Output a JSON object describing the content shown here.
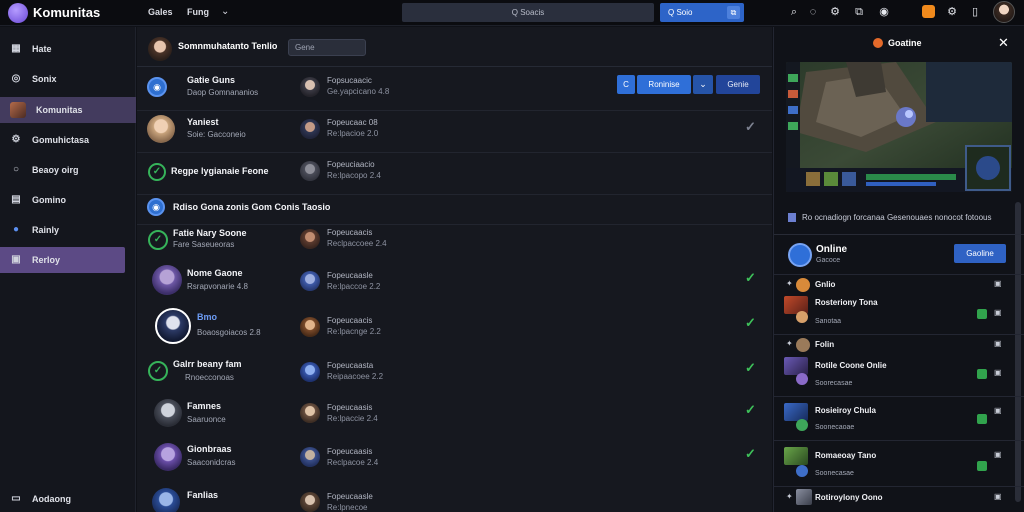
{
  "topbar": {
    "app_title": "Komunitas",
    "nav": [
      "Gales",
      "Fung"
    ],
    "search_placeholder": "Q Soacis",
    "search_button": "Q Soio",
    "search_button_extra": "⧉"
  },
  "sidebar": {
    "items": [
      {
        "label": "Hate",
        "icon": "grid-icon"
      },
      {
        "label": "Sonix",
        "icon": "compass-icon"
      },
      {
        "label": "Komunitas",
        "icon": "community-avatar"
      },
      {
        "label": "Gomuhictasa",
        "icon": "gear-icon"
      },
      {
        "label": "Beaoy oirg",
        "icon": "circle-icon"
      },
      {
        "label": "Gomino",
        "icon": "document-icon"
      },
      {
        "label": "Rainly",
        "icon": "blue-circle-icon"
      },
      {
        "label": "Rerloy",
        "icon": "square-icon"
      }
    ],
    "footer": "Aodaong"
  },
  "main": {
    "header_title": "Somnmuhatanto  Tenlio",
    "header_chip": "Gene",
    "actions": {
      "c": "C",
      "primary": "Roninise",
      "secondary": "Genie"
    },
    "rows": [
      {
        "name": "Gatie Guns",
        "sub": "Daop Gomnananios",
        "meta1": "Fopsucaacic",
        "meta2": "Ge.yapcicano 4.8"
      },
      {
        "name": "Yaniest",
        "sub": "Soie: Gacconeio",
        "meta1": "Fopeucaac 08",
        "meta2": "Re:lpacioe 2.0"
      },
      {
        "name": "Regpe lygianaie Feone",
        "sub": "",
        "meta1": "Fopeuciaacio",
        "meta2": "Re:lpacopo 2.4"
      },
      {
        "name": "Rdiso Gona zonis Gom Conis Taosio",
        "sub": "",
        "meta1": "",
        "meta2": ""
      },
      {
        "name": "Fatie Nary Soone",
        "sub": "Fare Saseueoras",
        "meta1": "Fopeucaacis",
        "meta2": "Reclpaccoee 2.4"
      },
      {
        "name": "Nome Gaone",
        "sub": "Rsrapvonarie 4.8",
        "meta1": "Fopeucaasle",
        "meta2": "Re:lpaccoe 2.2"
      },
      {
        "name": "Bmo",
        "sub": "Boaosgoiacos 2.8",
        "meta1": "Fopeucaacis",
        "meta2": "Re:lpacnge 2.2"
      },
      {
        "name": "Galrr beany fam",
        "sub": "Rnoecconoas",
        "meta1": "Fopeucaasta",
        "meta2": "Reipaacoee 2.2"
      },
      {
        "name": "Famnes",
        "sub": "Saaruonce",
        "meta1": "Fopeucaasis",
        "meta2": "Re:lpaccie 2.4"
      },
      {
        "name": "Gionbraas",
        "sub": "Saaconidcras",
        "meta1": "Fopeucaasis",
        "meta2": "Reclpacoe 2.4"
      },
      {
        "name": "Fanlias",
        "sub": "",
        "meta1": "Fopeucaasle",
        "meta2": "Re:lpnecoe"
      }
    ]
  },
  "right": {
    "header": "Goatine",
    "notice": "Ro ocnadiogn forcanaa Gesenouaes nonocot fotoous",
    "online_title": "Online",
    "online_sub": "Gacoce",
    "online_button": "Gaoline",
    "friends": [
      {
        "label": "Gnlio",
        "sub": ""
      },
      {
        "label": "Rosteriony Tona",
        "sub": "Sanotaa"
      },
      {
        "label": "Folin",
        "sub": ""
      },
      {
        "label": "Rotile Coone Onlie",
        "sub": "Soorecasae"
      },
      {
        "label": "Rosieiroy Chula",
        "sub": "Soonecaoae"
      },
      {
        "label": "Romaeoay Tano",
        "sub": "Soonecasae"
      },
      {
        "label": "Rotiroylony Oono",
        "sub": ""
      }
    ]
  }
}
